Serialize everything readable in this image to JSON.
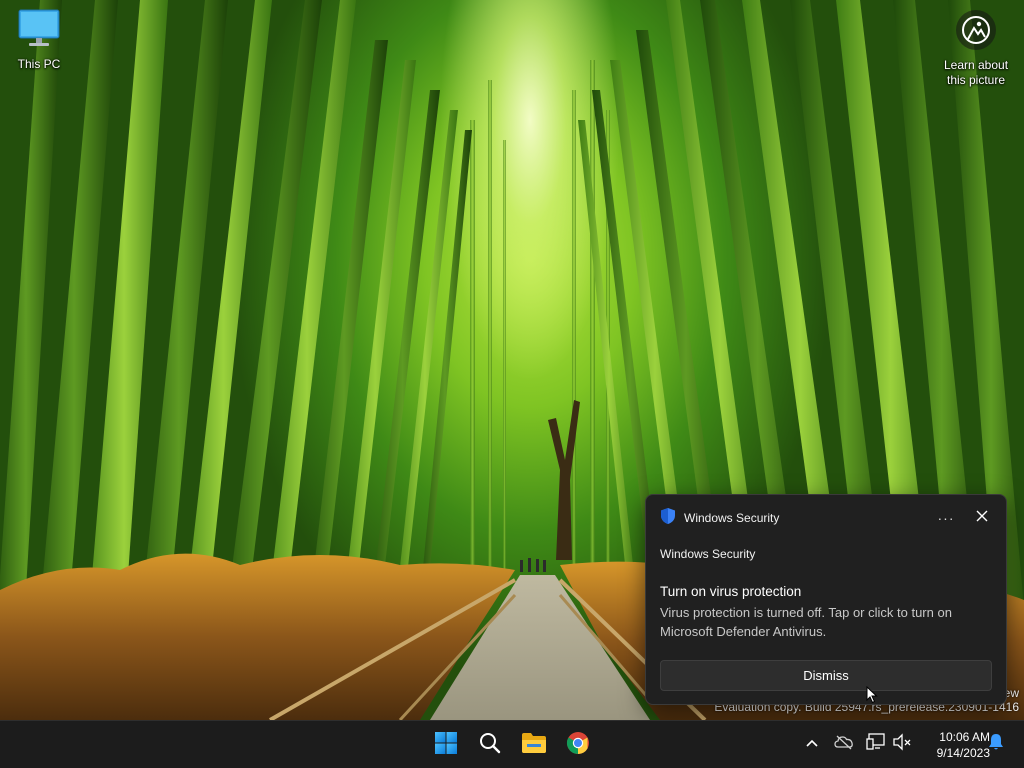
{
  "desktop": {
    "icons": [
      {
        "label": "This PC"
      }
    ],
    "spotlight": {
      "label_line1": "Learn about",
      "label_line2": "this picture"
    },
    "watermark": {
      "line1_fragment": "ew",
      "line2": "Evaluation copy. Build 25947.rs_prerelease.230901-1416"
    }
  },
  "toast": {
    "app_name": "Windows Security",
    "more_label": "···",
    "source": "Windows Security",
    "title": "Turn on virus protection",
    "body": "Virus protection is turned off. Tap or click to turn on Microsoft Defender Antivirus.",
    "dismiss_label": "Dismiss",
    "colors": {
      "background": "#202020",
      "shield": "#3b82f6"
    }
  },
  "taskbar": {
    "apps": [
      {
        "name": "start",
        "icon": "windows-logo-icon"
      },
      {
        "name": "search",
        "icon": "search-icon"
      },
      {
        "name": "file-explorer",
        "icon": "folder-icon"
      },
      {
        "name": "chrome",
        "icon": "chrome-icon"
      }
    ],
    "tray": {
      "icons": [
        "chevron-up-icon",
        "onedrive-offline-icon",
        "network-icon",
        "volume-muted-icon",
        "notification-bell-icon"
      ]
    },
    "clock": {
      "time": "10:06 AM",
      "date": "9/14/2023"
    }
  }
}
